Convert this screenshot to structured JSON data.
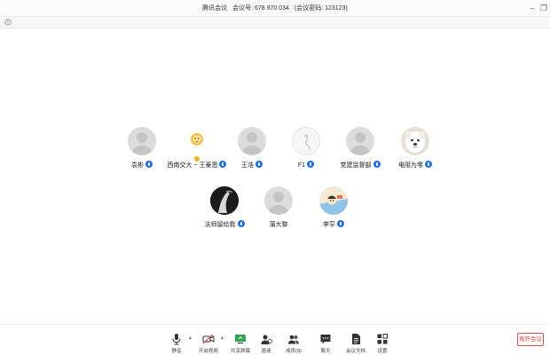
{
  "titlebar": {
    "app_name": "腾讯会议",
    "meeting_id": "会议号: 678 970 034",
    "password": "(会议密码: 123123)"
  },
  "participants": [
    {
      "name": "袁彬"
    },
    {
      "name": "西南交大 ~ 王豪恩"
    },
    {
      "name": "王浩"
    },
    {
      "name": "F1"
    },
    {
      "name": "党建监督部"
    },
    {
      "name": "电阻为零"
    },
    {
      "name": "法师留给我"
    },
    {
      "name": "蒲大黎"
    },
    {
      "name": "李亨"
    }
  ],
  "toolbar": {
    "mute": "静音",
    "video": "开启视频",
    "share": "共享屏幕",
    "invite": "邀请",
    "members": "成员(9)",
    "chat": "聊天",
    "docs": "会议文档",
    "settings": "设置",
    "leave": "离开会议"
  },
  "colors": {
    "accent": "#1e6fe6",
    "danger": "#e34b4b",
    "share_green": "#2aa84a"
  }
}
